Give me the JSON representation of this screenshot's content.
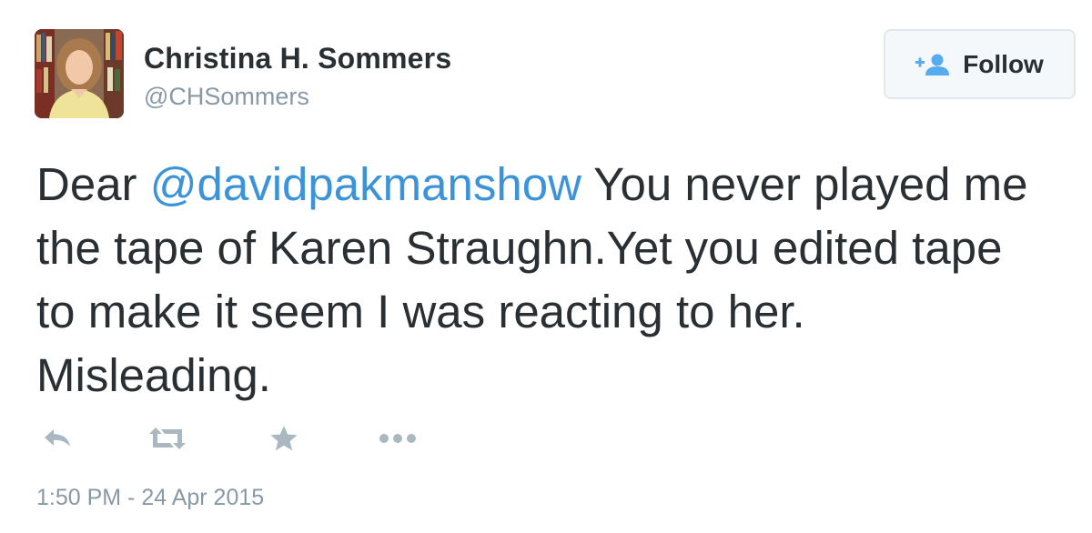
{
  "user": {
    "name": "Christina H. Sommers",
    "handle": "@CHSommers"
  },
  "follow_button": {
    "label": "Follow",
    "icon": "add-user-icon"
  },
  "tweet": {
    "text_before": "Dear ",
    "mention": "@davidpakmanshow",
    "text_after": " You never played me the tape of Karen Straughn.Yet you edited tape to make it seem I was reacting to her. Misleading."
  },
  "actions": [
    {
      "name": "reply",
      "icon": "reply-icon"
    },
    {
      "name": "retweet",
      "icon": "retweet-icon"
    },
    {
      "name": "favorite",
      "icon": "star-icon"
    },
    {
      "name": "more",
      "icon": "more-icon"
    }
  ],
  "timestamp": "1:50 PM - 24 Apr 2015",
  "colors": {
    "text": "#292f33",
    "muted": "#8899a6",
    "link": "#3b94d9",
    "icon": "#aab8c2",
    "follow_icon": "#55acee"
  }
}
